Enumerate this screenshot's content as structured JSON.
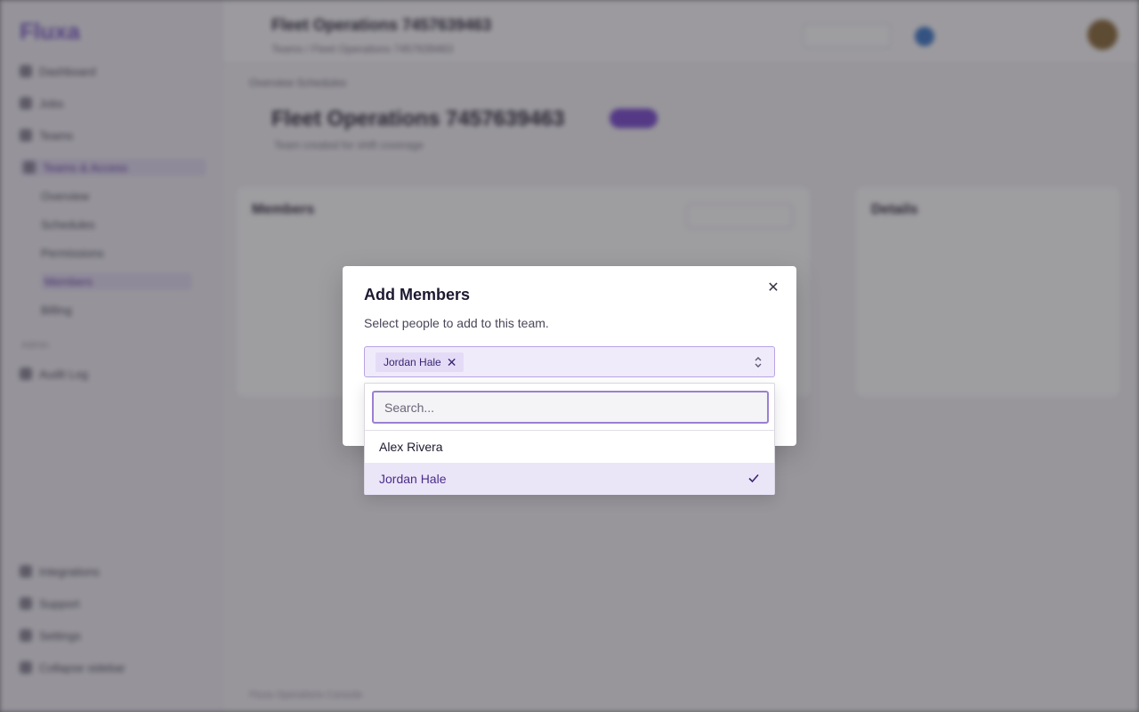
{
  "background": {
    "sidebar": {
      "logo": "Fluxa",
      "items": [
        "Dashboard",
        "Jobs",
        "Teams",
        "Teams & Access",
        "Overview",
        "Schedules",
        "Permissions",
        "Members",
        "Billing"
      ],
      "section_label": "Admin",
      "section_item": "Audit Log",
      "bottom_items": [
        "Integrations",
        "Support",
        "Settings",
        "Collapse sidebar"
      ]
    },
    "header": {
      "title": "Fleet Operations 7457639463",
      "crumbs": "Teams  /  Fleet Operations 7457639463"
    },
    "tabs": "Overview    Schedules",
    "hero_title": "Fleet Operations 7457639463",
    "hero_sub": "Team created for shift coverage",
    "card_members_title": "Members",
    "card_details_title": "Details",
    "footer": "Fluxa Operations Console"
  },
  "modal": {
    "title": "Add Members",
    "description": "Select people to add to this team.",
    "selected_chips": [
      {
        "label": "Jordan Hale"
      }
    ],
    "close_glyph": "✕",
    "chip_remove_glyph": "✕"
  },
  "dropdown": {
    "search_placeholder": "Search...",
    "options": [
      {
        "label": "Alex Rivera",
        "selected": false
      },
      {
        "label": "Jordan Hale",
        "selected": true
      }
    ],
    "check_glyph": "✓"
  },
  "colors": {
    "accent": "#7a4ad0",
    "selected_bg": "#ebe5f8",
    "field_bg": "#efebfb",
    "focus_border": "#9a80d2"
  }
}
